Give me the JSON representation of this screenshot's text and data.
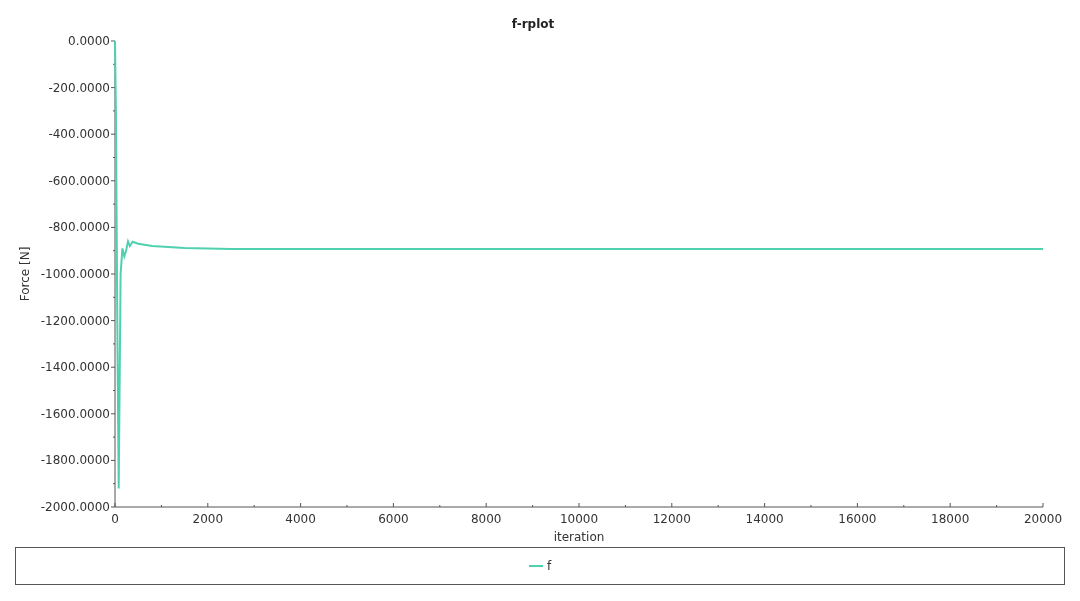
{
  "chart_data": {
    "type": "line",
    "title": "f-rplot",
    "xlabel": "iteration",
    "ylabel": "Force [N]",
    "x": [
      0,
      20,
      50,
      80,
      120,
      160,
      200,
      240,
      280,
      320,
      380,
      500,
      800,
      1500,
      2500,
      20000
    ],
    "series": [
      {
        "name": "f",
        "color": "#4fd1b0",
        "values": [
          0,
          -300,
          -1200,
          -1920,
          -1000,
          -890,
          -925,
          -900,
          -860,
          -880,
          -862,
          -870,
          -880,
          -888,
          -893,
          -893
        ]
      }
    ],
    "xlim": [
      0,
      20000
    ],
    "ylim": [
      -2000,
      0
    ],
    "xticks": [
      0,
      2000,
      4000,
      6000,
      8000,
      10000,
      12000,
      14000,
      16000,
      18000,
      20000
    ],
    "yticks": [
      {
        "value": 0,
        "label": "0.0000"
      },
      {
        "value": -200,
        "label": "-200.0000"
      },
      {
        "value": -400,
        "label": "-400.0000"
      },
      {
        "value": -600,
        "label": "-600.0000"
      },
      {
        "value": -800,
        "label": "-800.0000"
      },
      {
        "value": -1000,
        "label": "-1000.0000"
      },
      {
        "value": -1200,
        "label": "-1200.0000"
      },
      {
        "value": -1400,
        "label": "-1400.0000"
      },
      {
        "value": -1600,
        "label": "-1600.0000"
      },
      {
        "value": -1800,
        "label": "-1800.0000"
      },
      {
        "value": -2000,
        "label": "-2000.0000"
      }
    ]
  }
}
